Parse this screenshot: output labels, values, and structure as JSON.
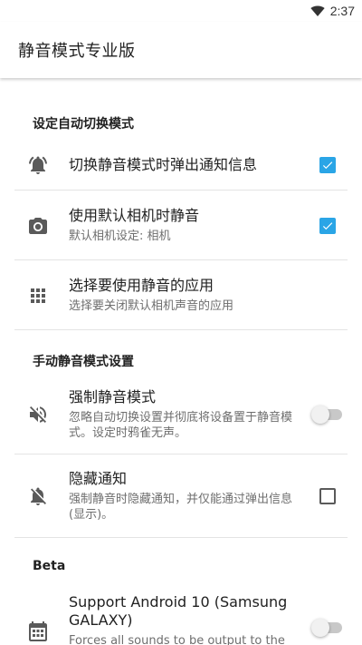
{
  "status_bar": {
    "time": "2:37"
  },
  "app_bar": {
    "title": "静音模式专业版"
  },
  "sections": {
    "auto": {
      "header": "设定自动切换模式"
    },
    "manual": {
      "header": "手动静音模式设置"
    },
    "beta": {
      "header": "Beta"
    }
  },
  "prefs": {
    "notify_on_switch": {
      "title": "切换静音模式时弹出通知信息",
      "checked": true,
      "icon": "bell-alert-icon"
    },
    "default_camera": {
      "title": "使用默认相机时静音",
      "summary": "默认相机设定: 相机",
      "checked": true,
      "icon": "camera-icon"
    },
    "choose_apps": {
      "title": "选择要使用静音的应用",
      "summary": "选择要关闭默认相机声音的应用",
      "icon": "apps-grid-icon"
    },
    "force_silent": {
      "title": "强制静音模式",
      "summary": "忽略自动切换设置并彻底将设备置于静音模式。设定时鸦雀无声。",
      "enabled": false,
      "icon": "volume-off-icon"
    },
    "hide_notification": {
      "title": "隐藏通知",
      "summary": "强制静音时隐藏通知，并仅能通过弹出信息(显示)。",
      "checked": false,
      "icon": "bell-off-icon"
    },
    "support_android10": {
      "title": "Support Android 10 (Samsung GALAXY)",
      "summary": "Forces all sounds to be output to the",
      "enabled": false,
      "icon": "calendar-grid-icon"
    }
  },
  "colors": {
    "accent": "#2aa5e6",
    "icon": "#5a5a5a",
    "divider": "#e4e4e4"
  }
}
